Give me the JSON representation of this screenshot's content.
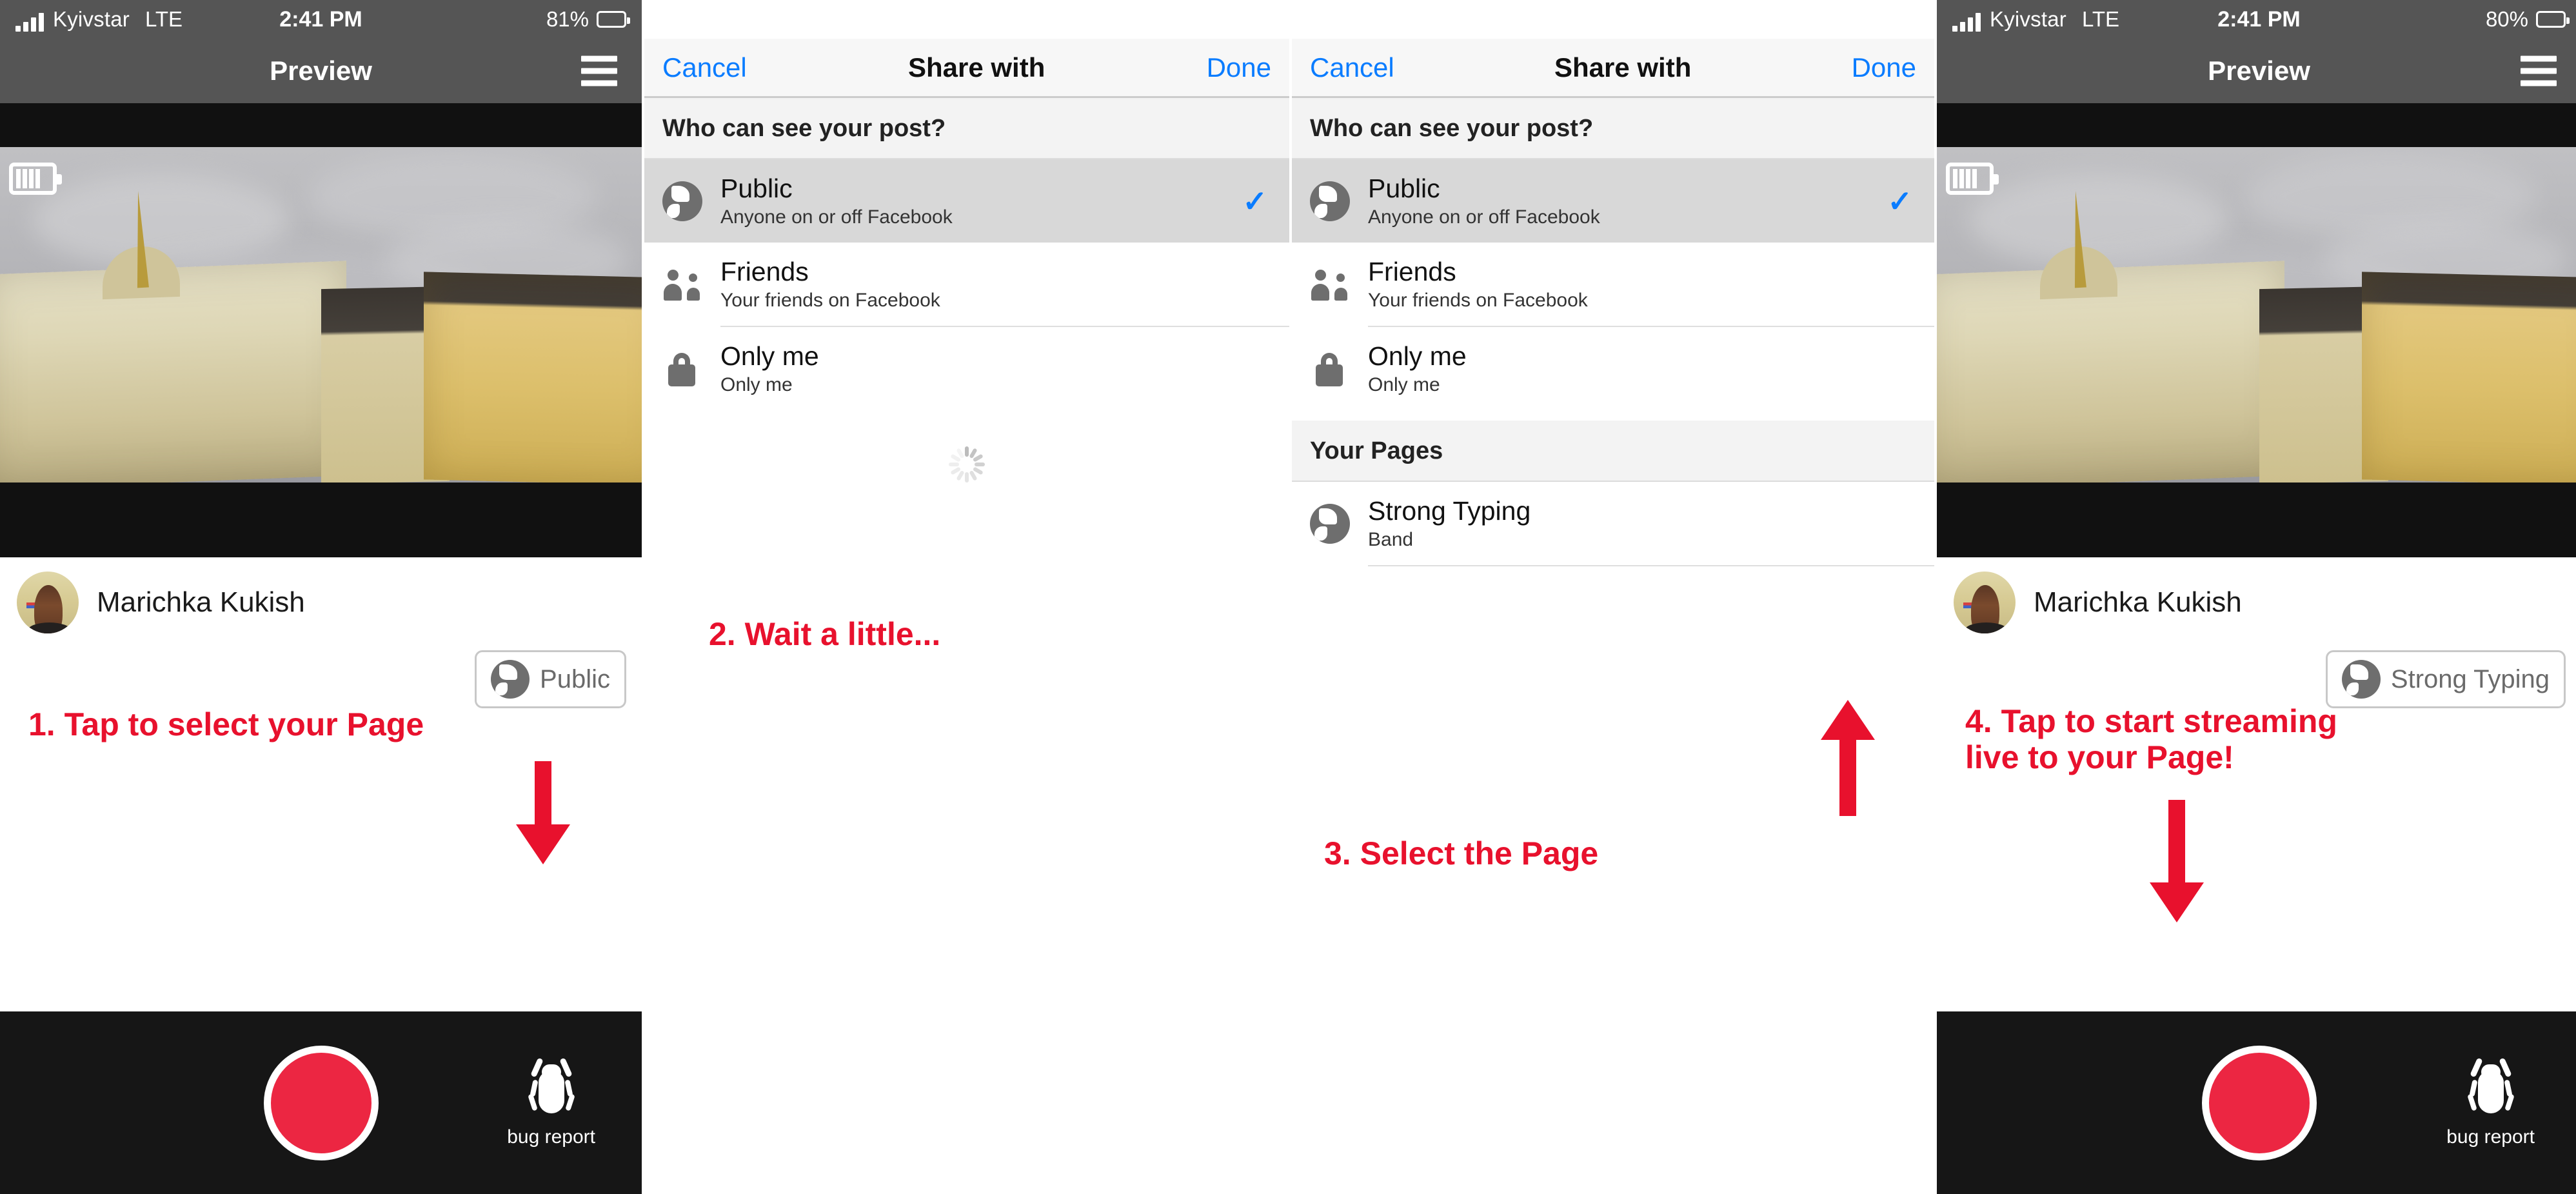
{
  "colors": {
    "accent_red": "#e8112d",
    "ios_blue": "#0a7cff",
    "nav_gray": "#555555",
    "record_red": "#ec2642",
    "selected_row": "#d8d8d8"
  },
  "panel1": {
    "status": {
      "carrier": "Kyivstar",
      "network": "LTE",
      "time": "2:41 PM",
      "battery": "81%"
    },
    "nav": {
      "title": "Preview"
    },
    "author": {
      "name": "Marichka Kukish"
    },
    "privacy_chip": {
      "label": "Public"
    },
    "bottom": {
      "bug_label": "bug report"
    },
    "annotation": {
      "text": "1. Tap to select your Page"
    }
  },
  "panel2": {
    "nav": {
      "cancel": "Cancel",
      "title": "Share with",
      "done": "Done"
    },
    "section_header": "Who can see your post?",
    "options": [
      {
        "icon": "globe-icon",
        "title": "Public",
        "subtitle": "Anyone on or off Facebook",
        "selected": true,
        "check": "✓"
      },
      {
        "icon": "people-icon",
        "title": "Friends",
        "subtitle": "Your friends on Facebook",
        "selected": false
      },
      {
        "icon": "lock-icon",
        "title": "Only me",
        "subtitle": "Only me",
        "selected": false
      }
    ],
    "loading": true,
    "annotation": {
      "text": "2. Wait a little..."
    }
  },
  "panel3": {
    "nav": {
      "cancel": "Cancel",
      "title": "Share with",
      "done": "Done"
    },
    "section_header": "Who can see your post?",
    "options": [
      {
        "icon": "globe-icon",
        "title": "Public",
        "subtitle": "Anyone on or off Facebook",
        "selected": true,
        "check": "✓"
      },
      {
        "icon": "people-icon",
        "title": "Friends",
        "subtitle": "Your friends on Facebook",
        "selected": false
      },
      {
        "icon": "lock-icon",
        "title": "Only me",
        "subtitle": "Only me",
        "selected": false
      }
    ],
    "pages_header": "Your Pages",
    "pages": [
      {
        "icon": "globe-icon",
        "title": "Strong Typing",
        "subtitle": "Band"
      }
    ],
    "annotation": {
      "text": "3. Select the Page"
    }
  },
  "panel4": {
    "status": {
      "carrier": "Kyivstar",
      "network": "LTE",
      "time": "2:41 PM",
      "battery": "80%"
    },
    "nav": {
      "title": "Preview"
    },
    "author": {
      "name": "Marichka Kukish"
    },
    "privacy_chip": {
      "label": "Strong Typing"
    },
    "bottom": {
      "bug_label": "bug report"
    },
    "annotation": {
      "text": "4. Tap to start streaming\nlive to your Page!"
    }
  }
}
